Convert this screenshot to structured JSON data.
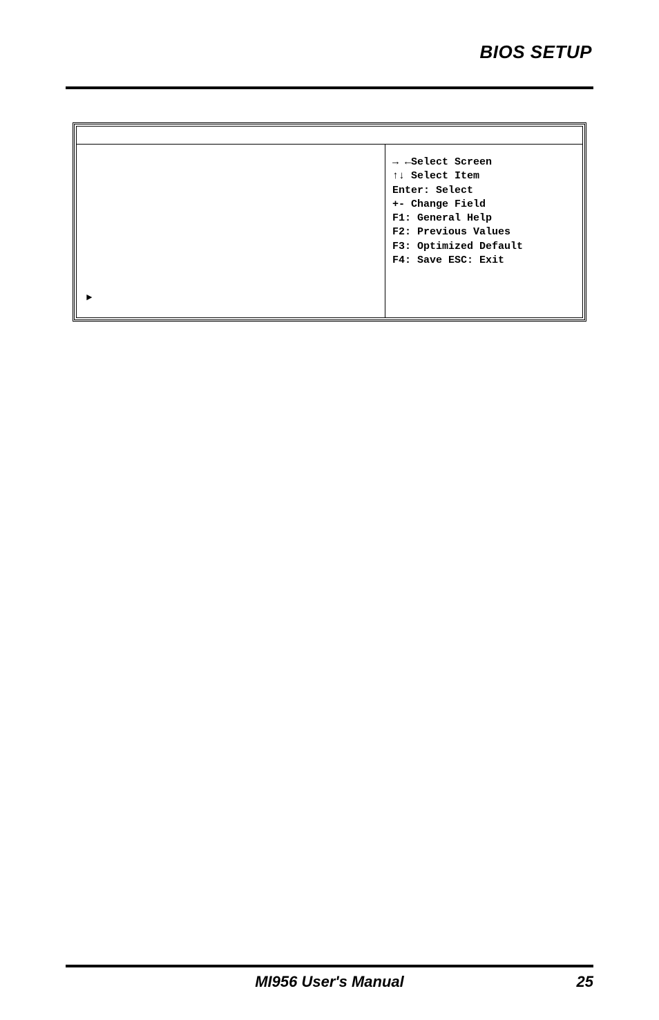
{
  "header": {
    "title": "BIOS SETUP"
  },
  "bios": {
    "help": {
      "select_screen": "→ ←Select Screen",
      "select_item": "↑↓ Select Item",
      "enter_select": "Enter: Select",
      "change_field": "+-  Change Field",
      "f1": "F1: General Help",
      "f2": "F2: Previous Values",
      "f3": "F3: Optimized Default",
      "f4": "F4: Save  ESC: Exit"
    },
    "marker": "►"
  },
  "footer": {
    "manual_title": "MI956 User's Manual",
    "page_number": "25"
  }
}
